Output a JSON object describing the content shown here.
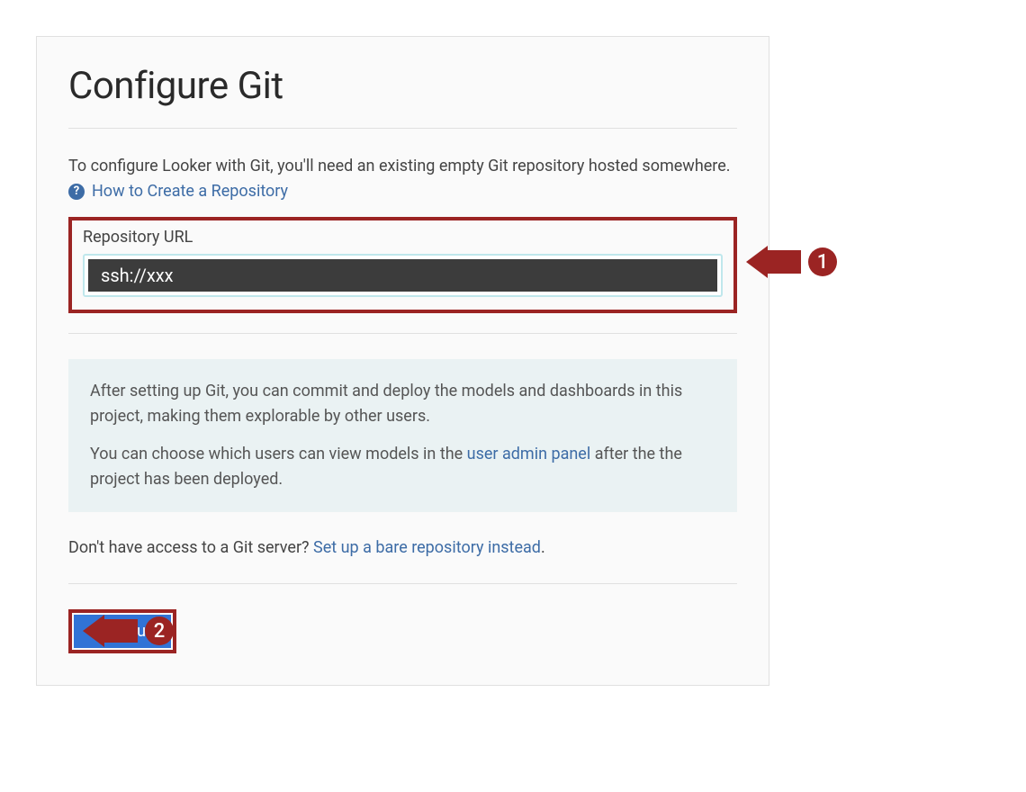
{
  "title": "Configure Git",
  "intro": "To configure Looker with Git, you'll need an existing empty Git repository hosted somewhere.",
  "help_link": "How to Create a Repository",
  "help_icon_glyph": "?",
  "repo": {
    "label": "Repository URL",
    "value": "ssh://xxx"
  },
  "info": {
    "paragraph1": "After setting up Git, you can commit and deploy the models and dashboards in this project, making them explorable by other users.",
    "paragraph2_before": "You can choose which users can view models in the ",
    "paragraph2_link": "user admin panel",
    "paragraph2_after": " after the the project has been deployed."
  },
  "alt": {
    "before": "Don't have access to a Git server? ",
    "link": "Set up a bare repository instead",
    "after": "."
  },
  "continue_label": "Continue",
  "annotations": {
    "one": "1",
    "two": "2"
  }
}
